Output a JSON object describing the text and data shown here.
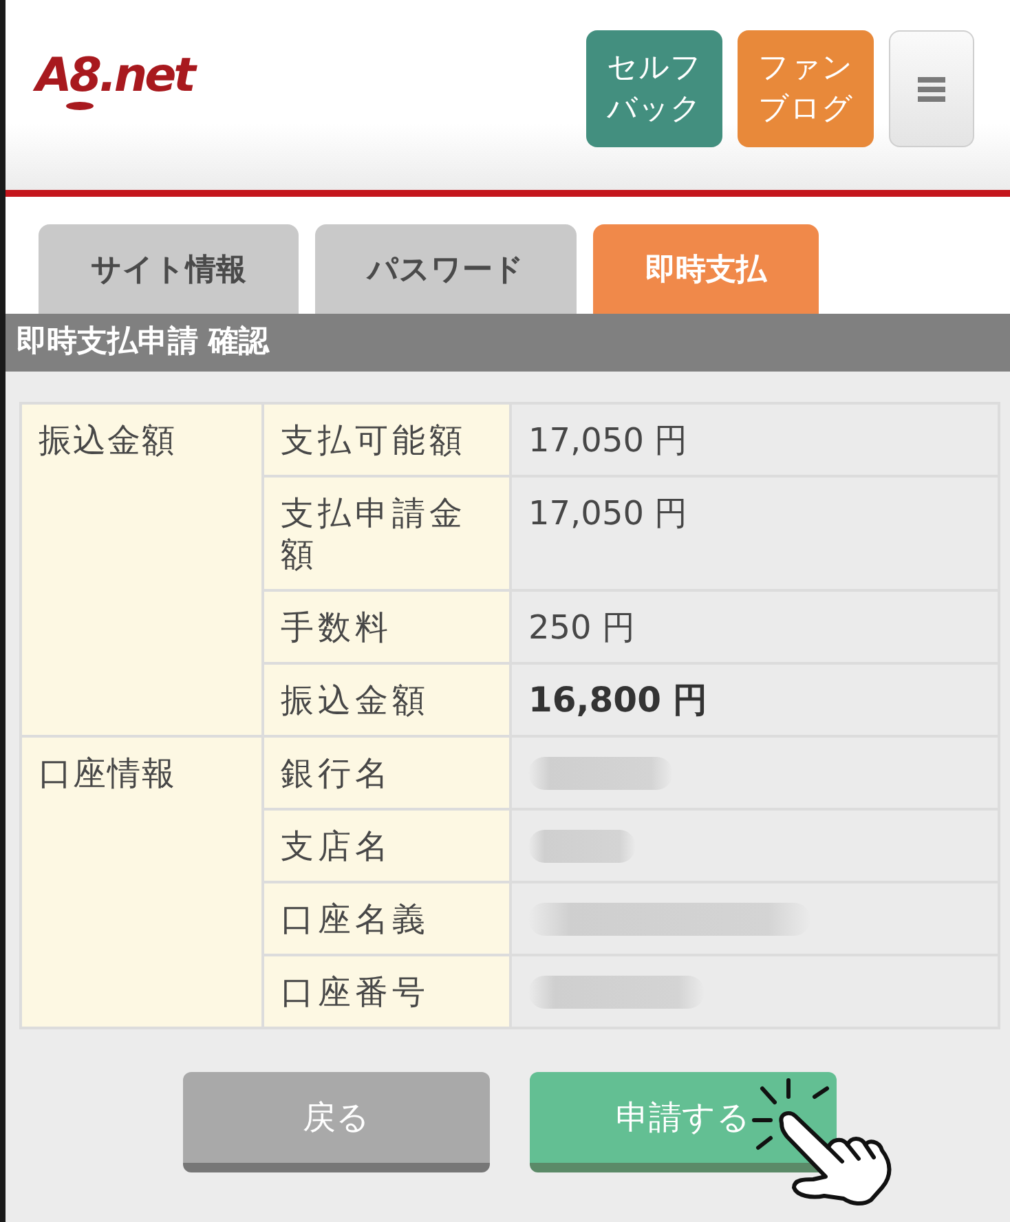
{
  "header": {
    "logo": "A8.net",
    "links": [
      {
        "label": "セルフバック",
        "color": "#438f7f"
      },
      {
        "label": "ファンブログ",
        "color": "#e8893a"
      }
    ]
  },
  "tabs": [
    {
      "label": "サイト情報",
      "selected": false
    },
    {
      "label": "パスワード",
      "selected": false
    },
    {
      "label": "即時支払",
      "selected": true
    }
  ],
  "section_title": "即時支払申請 確認",
  "details": {
    "groups": [
      {
        "label": "振込金額",
        "rows": [
          {
            "label": "支払可能額",
            "kind": "amount",
            "value": "17,050 円"
          },
          {
            "label": "支払申請金額",
            "kind": "amount",
            "value": "17,050 円"
          },
          {
            "label": "手数料",
            "kind": "amount",
            "value": "250 円"
          },
          {
            "label": "振込金額",
            "kind": "total",
            "value": "16,800 円"
          }
        ]
      },
      {
        "label": "口座情報",
        "rows": [
          {
            "label": "銀行名",
            "kind": "redacted"
          },
          {
            "label": "支店名",
            "kind": "redacted"
          },
          {
            "label": "口座名義",
            "kind": "redacted"
          },
          {
            "label": "口座番号",
            "kind": "redacted"
          }
        ]
      }
    ]
  },
  "actions": [
    {
      "label": "戻る",
      "kind": "secondary"
    },
    {
      "label": "申請する",
      "kind": "primary"
    }
  ]
}
